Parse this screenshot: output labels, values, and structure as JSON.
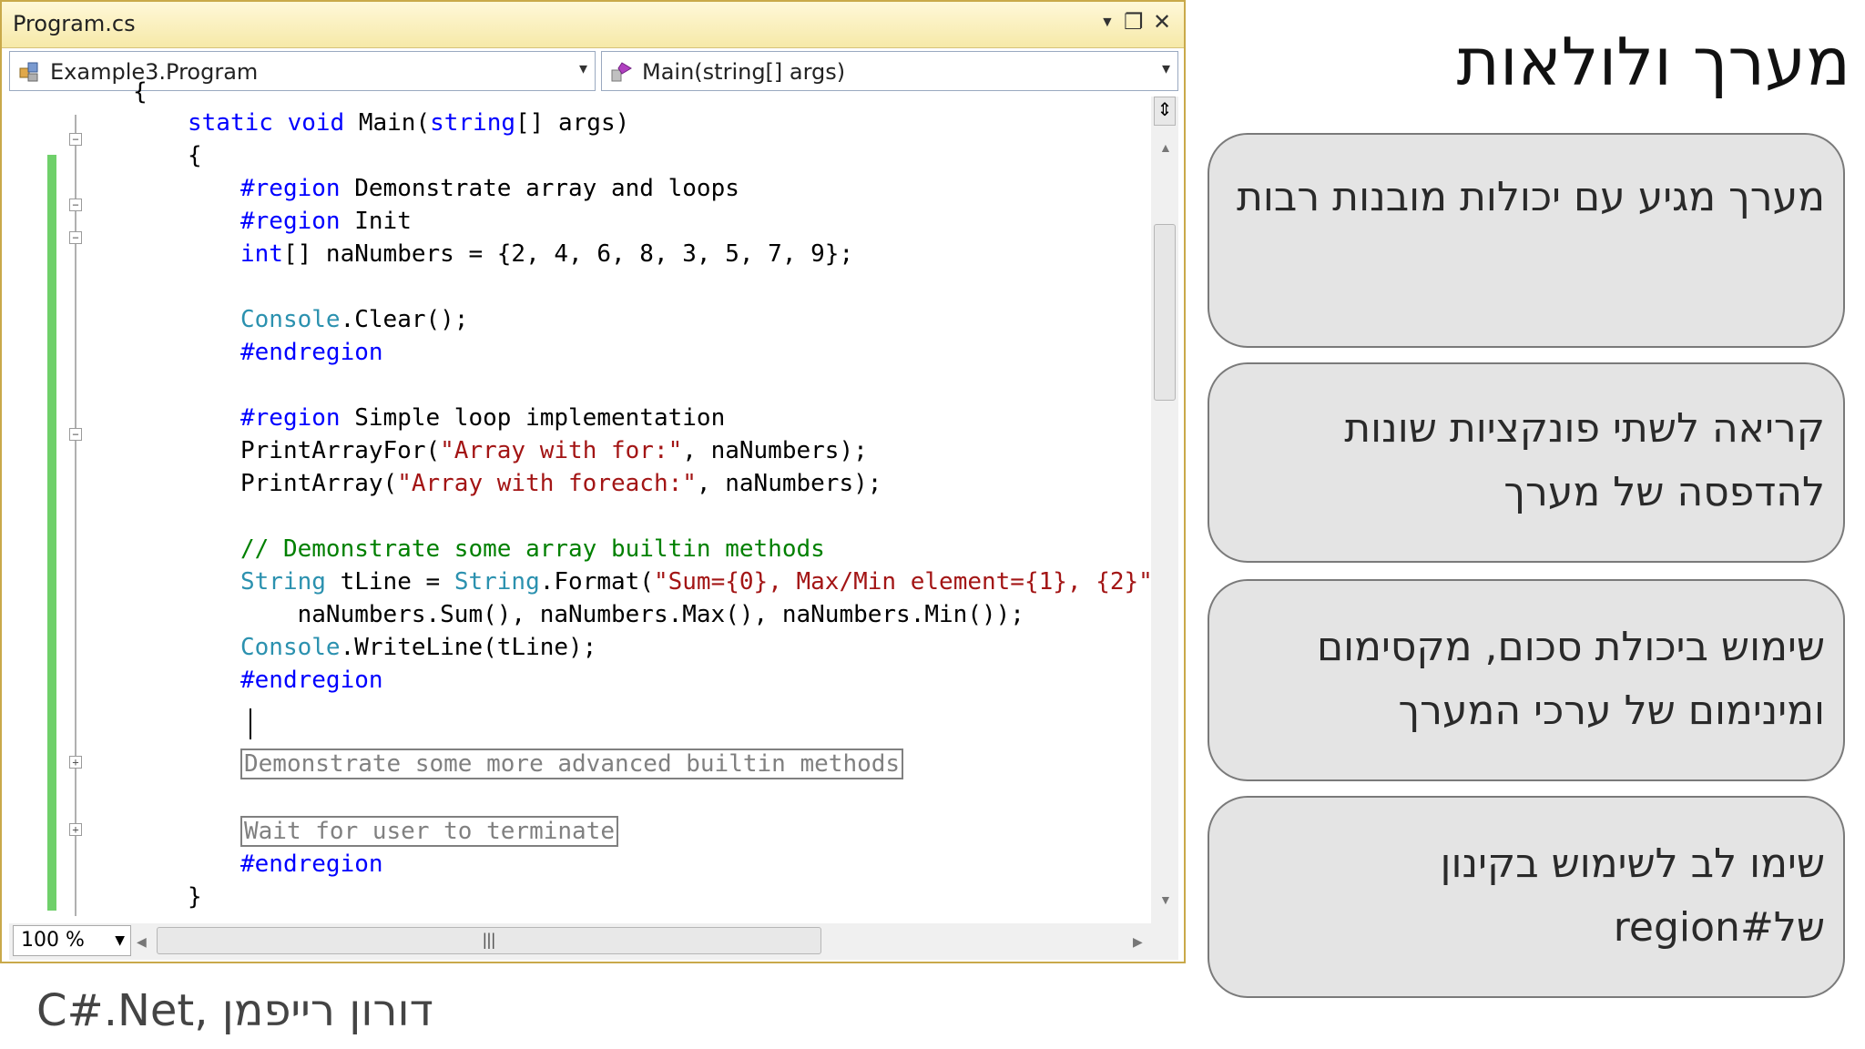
{
  "window": {
    "title": "Program.cs",
    "class_combo": "Example3.Program",
    "member_combo": "Main(string[] args)",
    "zoom": "100 %"
  },
  "code_lines": {
    "l0": "{",
    "l1_kw": "static void",
    "l1_rest": " Main(",
    "l1_kw2": "string",
    "l1_end": "[] args)",
    "l2": "{",
    "l3_kw": "#region",
    "l3_rest": " Demonstrate array and loops",
    "l4_kw": "#region",
    "l4_rest": " Init",
    "l5_kw": "int",
    "l5_rest": "[] naNumbers = {2, 4, 6, 8, 3, 5, 7, 9};",
    "l7_ty": "Console",
    "l7_rest": ".Clear();",
    "l8_kw": "#endregion",
    "l10_kw": "#region",
    "l10_rest": " Simple loop implementation",
    "l11_a": "PrintArrayFor(",
    "l11_str": "\"Array with for:\"",
    "l11_b": ", naNumbers);",
    "l12_a": "PrintArray(",
    "l12_str": "\"Array with foreach:\"",
    "l12_b": ", naNumbers);",
    "l14_cm": "// Demonstrate some array builtin methods",
    "l15_ty": "String",
    "l15_a": " tLine = ",
    "l15_ty2": "String",
    "l15_b": ".Format(",
    "l15_str": "\"Sum={0}, Max/Min element={1}, {2}\"",
    "l15_c": ",",
    "l16": "    naNumbers.Sum(), naNumbers.Max(), naNumbers.Min());",
    "l17_ty": "Console",
    "l17_rest": ".WriteLine(tLine);",
    "l18_kw": "#endregion",
    "l20_box": "Demonstrate some more advanced builtin methods",
    "l22_box": "Wait for user to terminate",
    "l23_kw": "#endregion",
    "l24": "}"
  },
  "slide": {
    "title": "מערך ולולאות",
    "bullets": [
      "מערך מגיע עם יכולות מובנות רבות",
      "קריאה לשתי פונקציות שונות להדפסה של מערך",
      "שימוש ביכולת סכום, מקסימום ומינימום של ערכי המערך",
      "שימו לב לשימוש בקינון של#region"
    ],
    "footer": "C#.Net, דורון רייפמן"
  },
  "colors": {
    "keyword": "#0000ff",
    "type": "#2b91af",
    "string": "#a31515",
    "comment": "#008000",
    "changed_bar": "#6fd06a"
  },
  "icons": [
    "class-icon",
    "method-icon",
    "dropdown-icon",
    "close-icon",
    "maximize-icon",
    "pin-icon",
    "split-icon"
  ]
}
